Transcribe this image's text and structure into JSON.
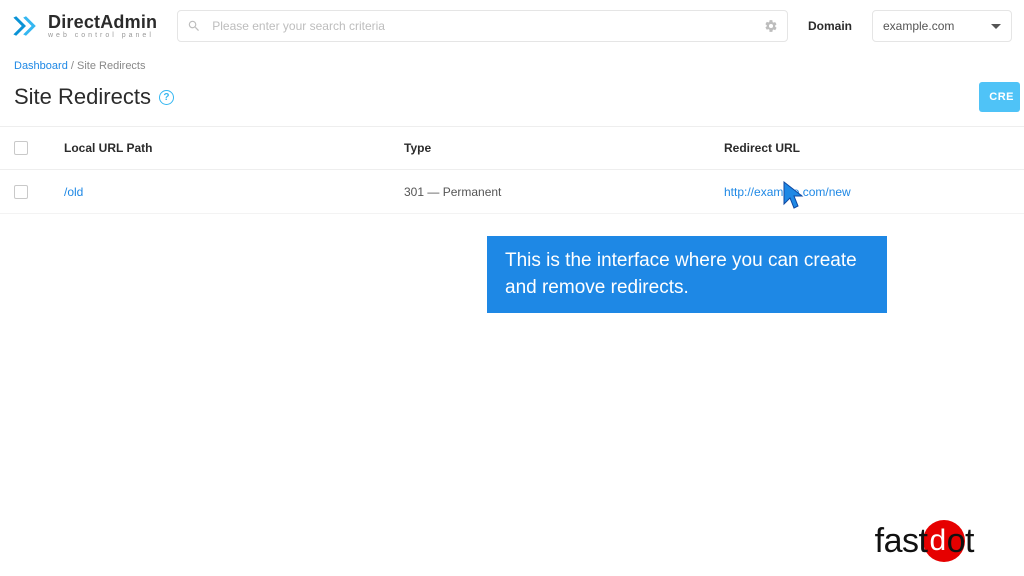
{
  "header": {
    "logo_title": "DirectAdmin",
    "logo_subtitle": "web control panel",
    "search_placeholder": "Please enter your search criteria",
    "domain_label": "Domain",
    "domain_selected": "example.com"
  },
  "breadcrumb": {
    "root": "Dashboard",
    "current": "Site Redirects"
  },
  "page": {
    "title": "Site Redirects",
    "create_label": "CRE"
  },
  "table": {
    "headers": {
      "path": "Local URL Path",
      "type": "Type",
      "redirect": "Redirect URL"
    },
    "rows": [
      {
        "path": "/old",
        "type": "301 — Permanent",
        "redirect": "http://example.com/new"
      }
    ]
  },
  "tooltip": {
    "text": "This is the interface where you can create and remove redirects."
  },
  "brand": {
    "text": "fastdot"
  }
}
